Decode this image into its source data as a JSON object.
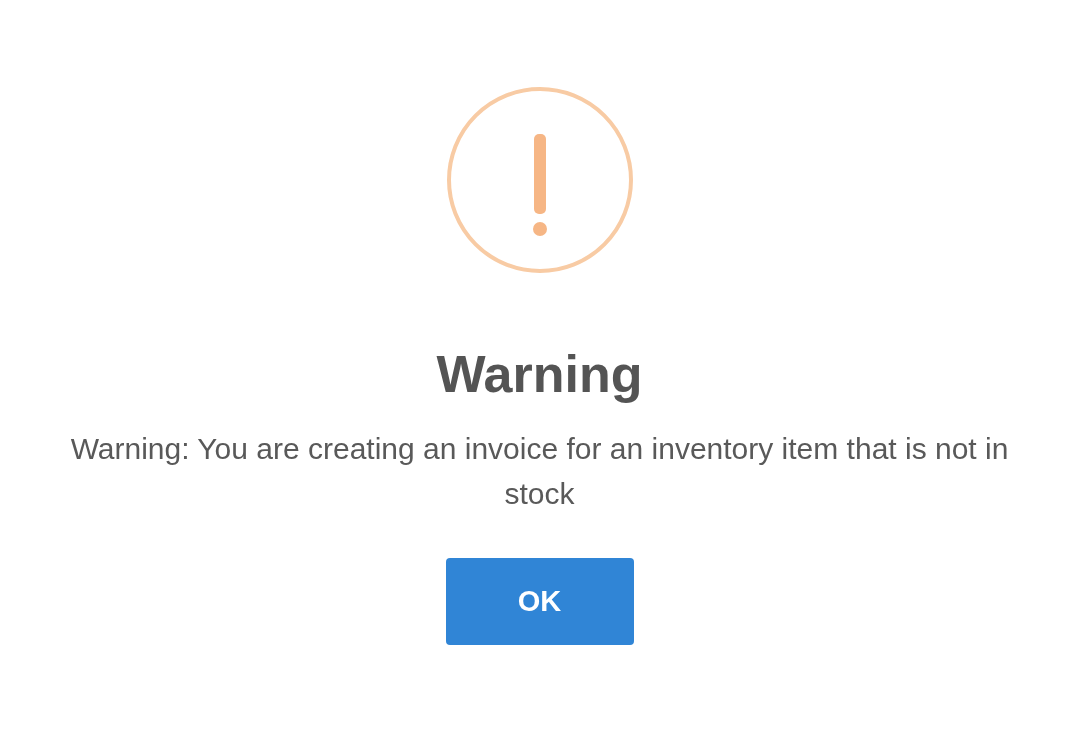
{
  "dialog": {
    "title": "Warning",
    "message": "Warning: You are creating an invoice for an inventory item that is not in stock",
    "buttons": [
      "OK"
    ]
  }
}
